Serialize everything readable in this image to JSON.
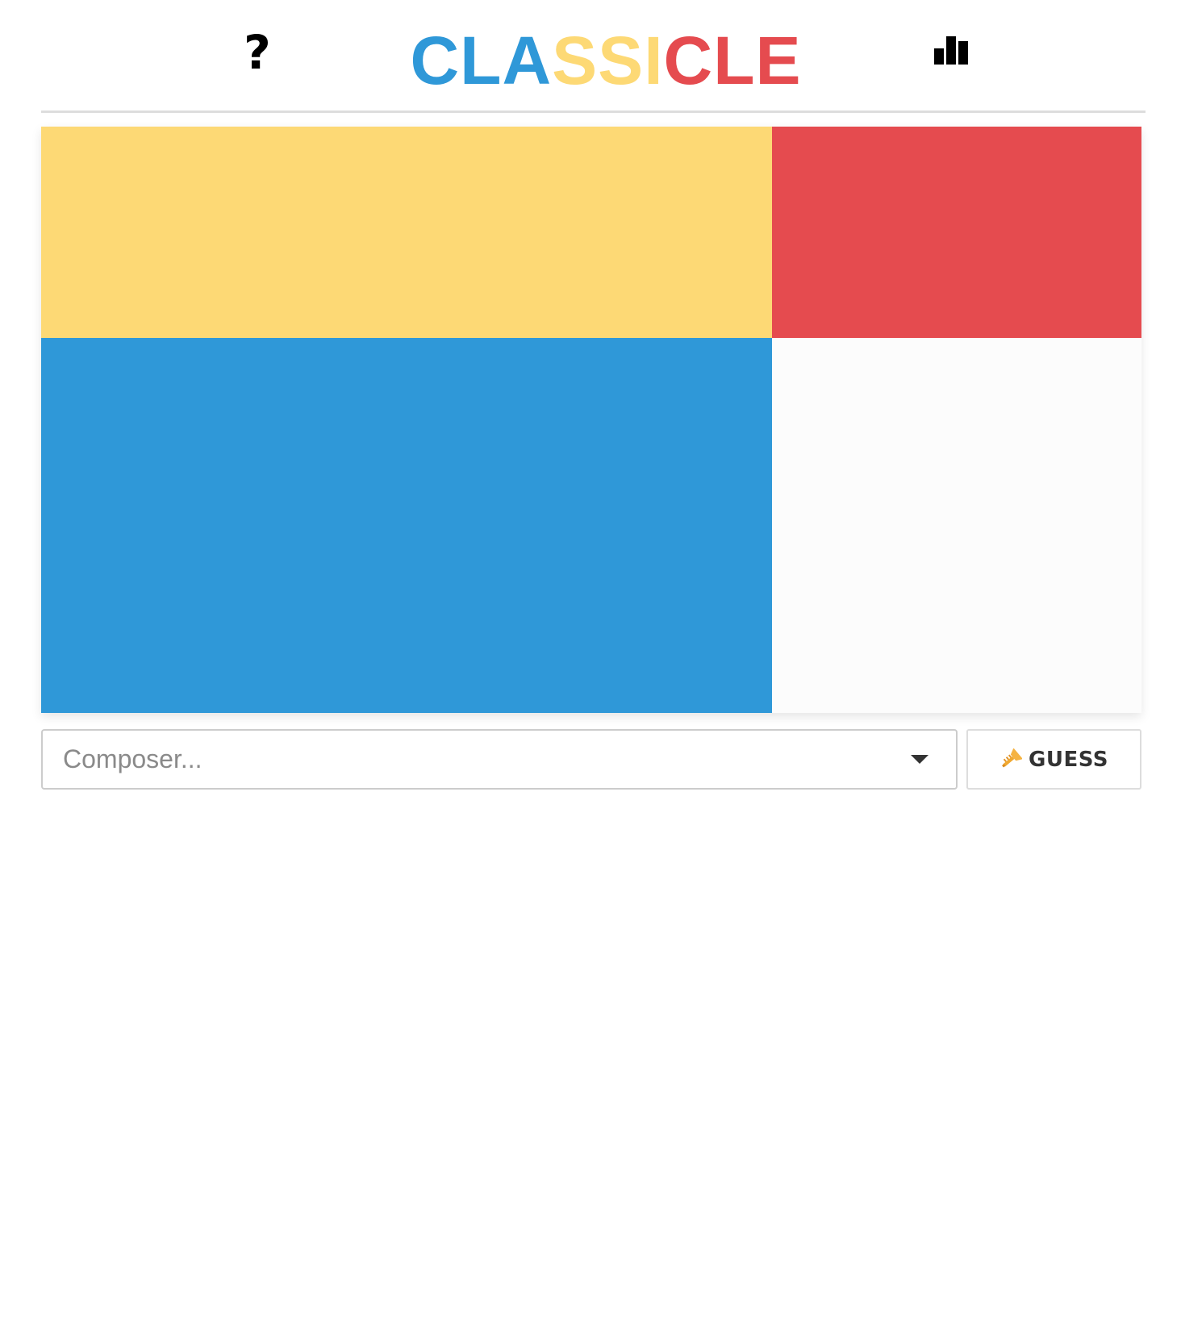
{
  "header": {
    "help_glyph": "?",
    "logo": {
      "letters": [
        {
          "char": "C",
          "color": "#2f98d8"
        },
        {
          "char": "L",
          "color": "#2f98d8"
        },
        {
          "char": "A",
          "color": "#2f98d8"
        },
        {
          "char": "S",
          "color": "#fdd975"
        },
        {
          "char": "S",
          "color": "#fdd975"
        },
        {
          "char": "I",
          "color": "#fdd975"
        },
        {
          "char": "C",
          "color": "#e54b4f"
        },
        {
          "char": "L",
          "color": "#e54b4f"
        },
        {
          "char": "E",
          "color": "#e54b4f"
        }
      ]
    },
    "stats_icon": "bar-chart-icon"
  },
  "board": {
    "tiles": [
      {
        "name": "tile-yellow",
        "color": "#fdd975"
      },
      {
        "name": "tile-red",
        "color": "#e54b4f"
      },
      {
        "name": "tile-blue",
        "color": "#2f98d8"
      },
      {
        "name": "tile-empty",
        "color": "#fcfcfc"
      }
    ]
  },
  "composer": {
    "placeholder": "Composer...",
    "caret_icon": "caret-down-icon"
  },
  "guess": {
    "label": "GUESS",
    "icon": "trumpet-icon"
  }
}
